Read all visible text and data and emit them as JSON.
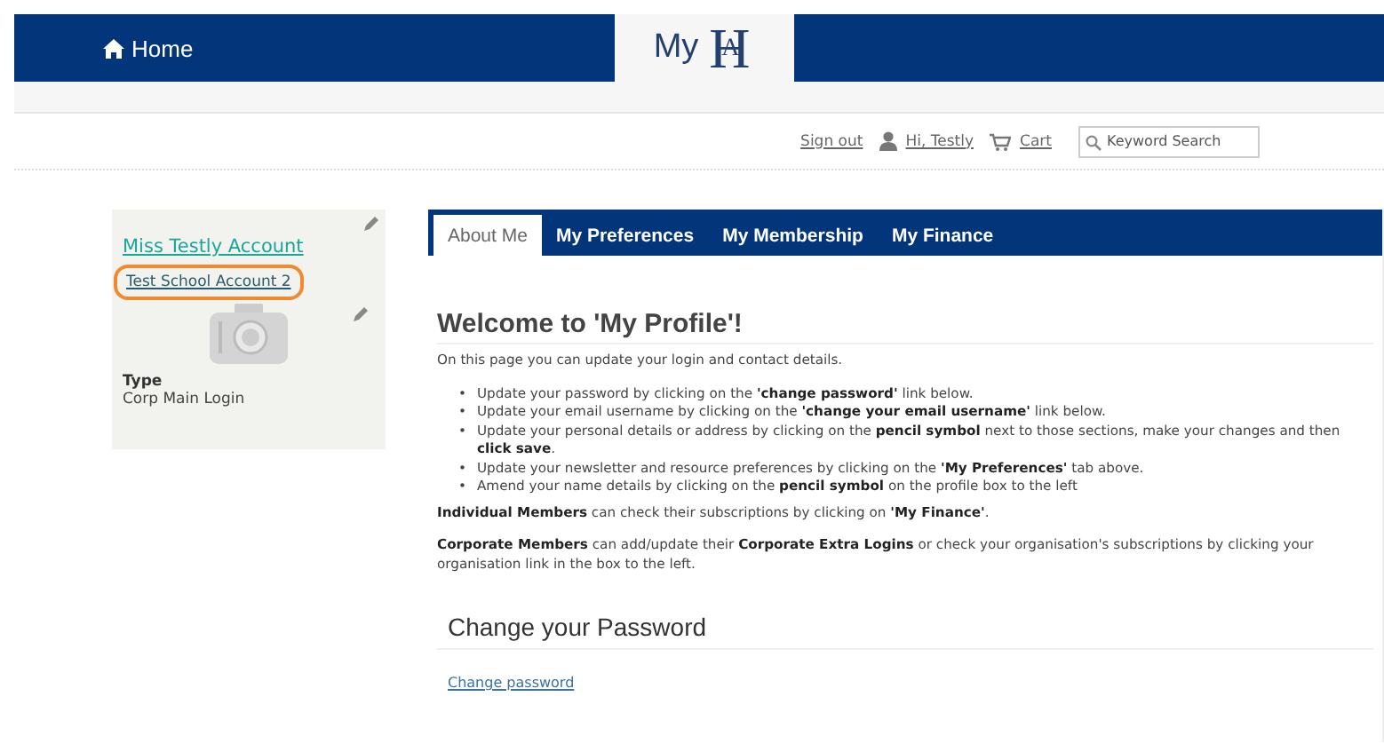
{
  "header": {
    "home": "Home",
    "logo": {
      "text": "My",
      "letters": [
        "H",
        "A"
      ]
    }
  },
  "utility": {
    "sign_out": "Sign out",
    "greeting": "Hi, Testly",
    "cart": "Cart",
    "search": {
      "placeholder": "Keyword Search"
    }
  },
  "profile": {
    "name": "Miss Testly Account",
    "organisation": {
      "label": "Test School Account 2",
      "highlighted": true
    },
    "type_label": "Type",
    "type_value": "Corp Main Login"
  },
  "tabs": [
    {
      "label": "About Me",
      "selected": true
    },
    {
      "label": "My Preferences",
      "selected": false
    },
    {
      "label": "My Membership",
      "selected": false
    },
    {
      "label": "My Finance",
      "selected": false
    }
  ],
  "content": {
    "title": "Welcome to 'My Profile'!",
    "intro": "On this page you can update your login and contact details.",
    "bullet_marker": "•",
    "bullets": [
      "Update your password by clicking on the **'change password'** link below.",
      "Update your email username by clicking on the **'change your email username'** link below.",
      "Update your personal details or address by clicking on the **pencil symbol** next to those sections, make your changes and then **click save**.",
      "Update your newsletter and resource preferences by clicking on the **'My Preferences'** tab above.",
      "Amend your name details by clicking on the **pencil symbol** on the profile box to the left"
    ],
    "paragraphs": [
      "**Individual Members** can check their subscriptions by clicking on **'My Finance'**.",
      "**Corporate Members** can add/update their **Corporate Extra Logins** or check your organisation's subscriptions by clicking your organisation link in the box to the left."
    ],
    "section_title": "Change your Password",
    "link": "Change password"
  }
}
